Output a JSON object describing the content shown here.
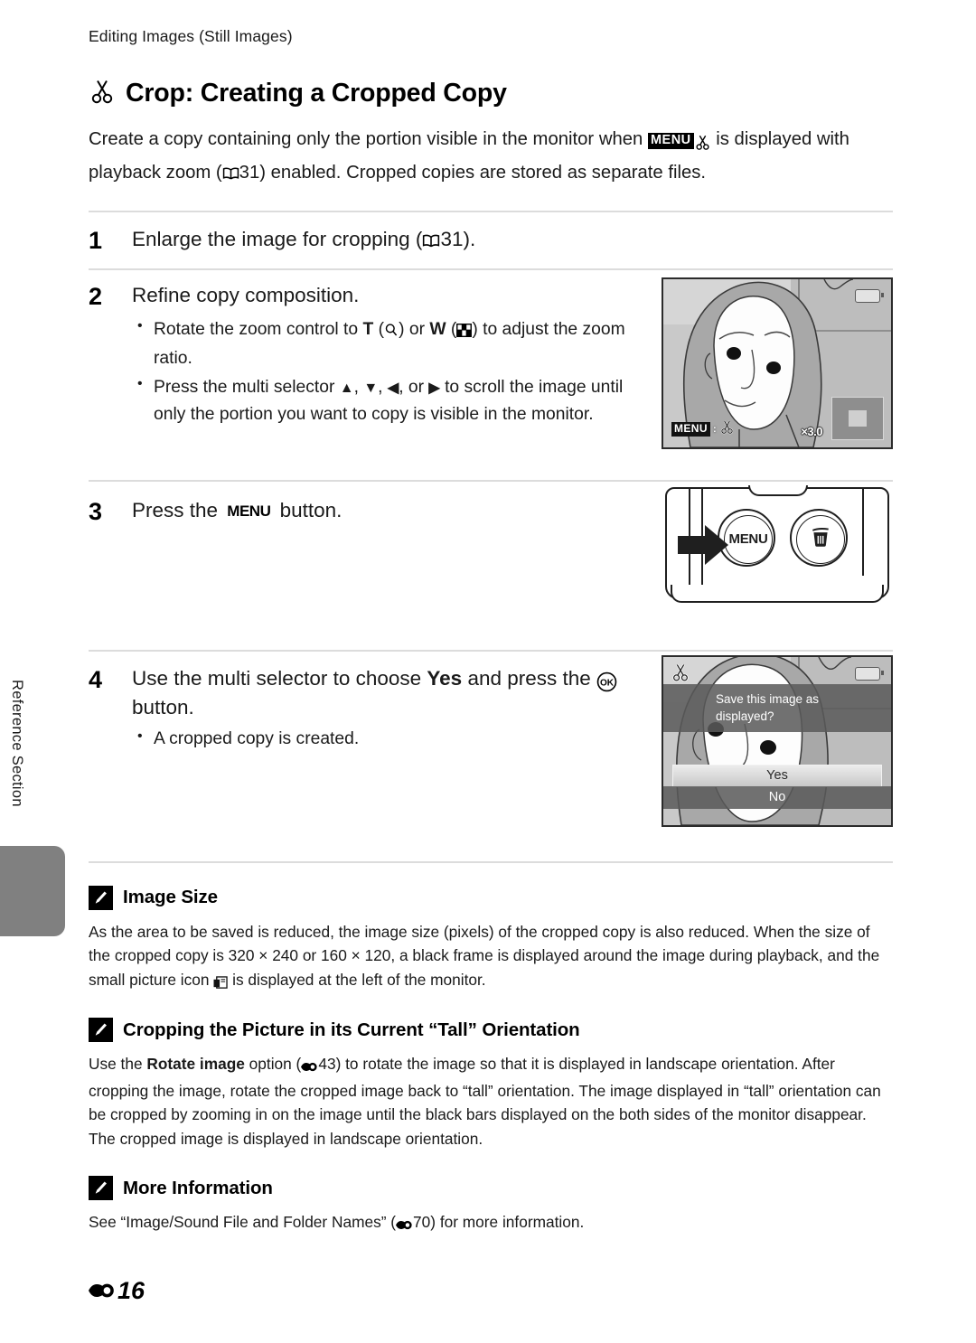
{
  "running_head": "Editing Images (Still Images)",
  "title": {
    "icon": "scissors-crop-icon",
    "text": "Crop: Creating a Cropped Copy"
  },
  "intro": {
    "part1": "Create a copy containing only the portion visible in the monitor when ",
    "menu_badge": "MENU",
    "scissors_icon": "scissors-icon",
    "part2": " is displayed with playback zoom (",
    "book_icon": "book-icon",
    "ref1": "31",
    "part3": ") enabled. Cropped copies are stored as separate files."
  },
  "steps": [
    {
      "num": "1",
      "heading_pre": "Enlarge the image for cropping (",
      "book_icon": "book-icon",
      "heading_ref": "31",
      "heading_post": ").",
      "bullets": []
    },
    {
      "num": "2",
      "heading": "Refine copy composition.",
      "bullets": [
        "Rotate the zoom control to T (magnify-icon) or W (thumbnail-icon) to adjust the zoom ratio.",
        "Press the multi selector ▲, ▼, ◀, or ▶ to scroll the image until only the portion you want to copy is visible in the monitor."
      ],
      "bullet1": {
        "a": "Rotate the zoom control to ",
        "t": "T",
        "b": " (",
        "zoom_in_icon": "magnify-icon",
        "c": ") or ",
        "w": "W",
        "d": " (",
        "zoom_out_icon": "thumbnail-grid-icon",
        "e": ") to adjust the zoom ratio."
      },
      "bullet2": {
        "a": "Press the multi selector ",
        "up": "▲",
        "b": ", ",
        "down": "▼",
        "c": ", ",
        "left": "◀",
        "d": ", or ",
        "right": "▶",
        "e": " to scroll the image until only the portion you want to copy is visible in the monitor."
      }
    },
    {
      "num": "3",
      "heading_pre": "Press the ",
      "menu_badge": "MENU",
      "heading_post": " button."
    },
    {
      "num": "4",
      "heading_a": "Use the multi selector to choose ",
      "heading_yes": "Yes",
      "heading_b": " and press the ",
      "ok_icon": "ok-button-icon",
      "heading_c": " button.",
      "note": "A cropped copy is created."
    }
  ],
  "figures": {
    "monitor": {
      "name": "playback-zoom-monitor",
      "menu_badge": "MENU",
      "scissors_icon": "scissors-icon",
      "zoom_ratio": "×3.0",
      "battery_icon": "battery-icon",
      "crop_preview_icon": "crop-preview-box"
    },
    "camera_back": {
      "name": "camera-rear-buttons",
      "menu_label": "MENU",
      "delete_icon": "trash-can-icon",
      "arrow_icon": "arrow-right-icon"
    },
    "dialog": {
      "name": "save-confirmation-monitor",
      "scissors_icon": "scissors-icon",
      "battery_icon": "battery-icon",
      "message_line1": "Save this image as",
      "message_line2": "displayed?",
      "yes_label": "Yes",
      "no_label": "No"
    }
  },
  "notes": [
    {
      "icon": "pencil-note-icon",
      "title": "Image Size",
      "body_a": "As the area to be saved is reduced, the image size (pixels) of the cropped copy is also reduced. When the size of the cropped copy is 320 × 240 or 160 × 120, a black frame is displayed around the image during playback, and the small picture icon ",
      "small_picture_icon": "small-picture-icon",
      "body_b": " is displayed at the left of the monitor."
    },
    {
      "icon": "pencil-note-icon",
      "title": "Cropping the Picture in its Current “Tall” Orientation",
      "body_a": "Use the ",
      "bold1": "Rotate image",
      "body_b": " option (",
      "e_icon": "e-reference-icon",
      "ref": "43",
      "body_c": ") to rotate the image so that it is displayed in landscape orientation. After cropping the image, rotate the cropped image back to “tall” orientation. The image displayed in “tall” orientation can be cropped by zooming in on the image until the black bars displayed on the both sides of the monitor disappear. The cropped image is displayed in landscape orientation."
    },
    {
      "icon": "pencil-note-icon",
      "title": "More Information",
      "body_a": "See “Image/Sound File and Folder Names” (",
      "e_icon": "e-reference-icon",
      "ref": "70",
      "body_b": ") for more information."
    }
  ],
  "sidebar": {
    "label": "Reference Section",
    "tab": "section-tab"
  },
  "footer": {
    "e_icon": "e-reference-icon",
    "page": "16"
  },
  "colors": {
    "rule": "#dcdcdc",
    "tab_gray": "#808080",
    "ink": "#1a1a1a"
  }
}
